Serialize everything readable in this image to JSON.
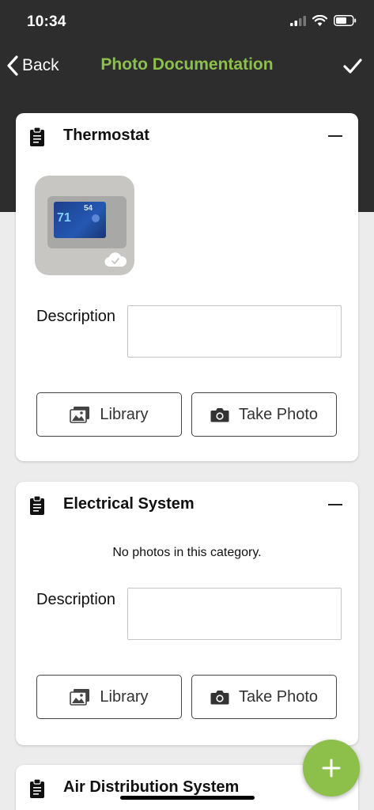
{
  "status_bar": {
    "time": "10:34"
  },
  "nav": {
    "back_label": "Back",
    "title": "Photo Documentation"
  },
  "sections": [
    {
      "title": "Thermostat",
      "thumbnail": {
        "reading_primary": "71",
        "reading_secondary": "54"
      },
      "description_label": "Description",
      "description_value": "",
      "library_label": "Library",
      "take_photo_label": "Take Photo"
    },
    {
      "title": "Electrical System",
      "empty_message": "No photos in this category.",
      "description_label": "Description",
      "description_value": "",
      "library_label": "Library",
      "take_photo_label": "Take Photo"
    },
    {
      "title": "Air Distribution System"
    }
  ],
  "colors": {
    "accent": "#8dc04b",
    "header_bg": "#2d2d2d",
    "page_bg": "#ececec"
  },
  "icons": [
    "chevron-left-icon",
    "checkmark-icon",
    "clipboard-icon",
    "minus-icon",
    "image-icon",
    "camera-icon",
    "cloud-check-icon",
    "plus-icon"
  ]
}
